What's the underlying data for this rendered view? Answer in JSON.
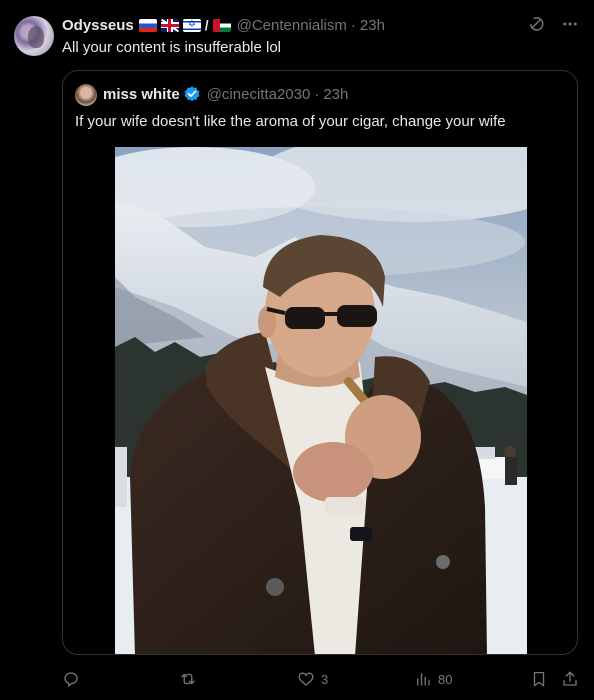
{
  "post": {
    "display_name": "Odysseus",
    "flag_separator": "/",
    "flags": [
      "russia-flag",
      "uk-flag",
      "israel-flag",
      "palestine-flag"
    ],
    "handle": "@Centennialism",
    "separator": "·",
    "time": "23h",
    "text": "All your content is insufferable lol"
  },
  "quote": {
    "display_name": "miss white",
    "verified": true,
    "handle": "@cinecitta2030",
    "separator": "·",
    "time": "23h",
    "text": "If your wife doesn't like the aroma of your cigar, change your wife",
    "media": "photo of man in sunglasses and fur-collared coat lighting a cigar in front of snowy mountains"
  },
  "actions": {
    "reply_count": "",
    "repost_count": "",
    "like_count": "3",
    "view_count": "80"
  },
  "colors": {
    "background": "#000000",
    "text_primary": "#e7e9ea",
    "text_secondary": "#71767b",
    "border": "#2f3336",
    "verified_blue": "#1d9bf0"
  }
}
